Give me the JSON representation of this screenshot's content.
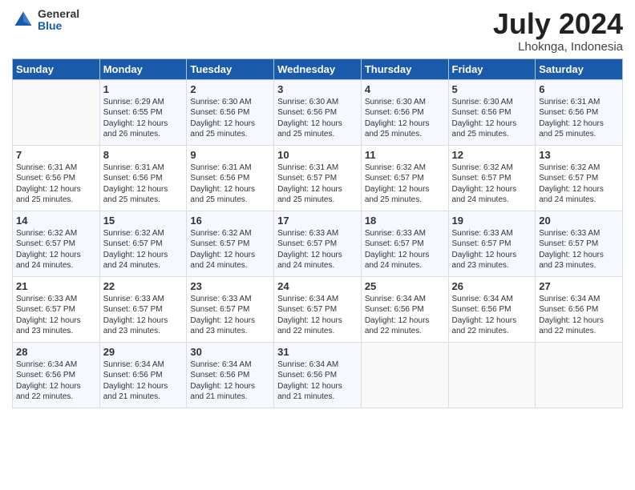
{
  "header": {
    "logo_general": "General",
    "logo_blue": "Blue",
    "month_year": "July 2024",
    "location": "Lhoknga, Indonesia"
  },
  "days_of_week": [
    "Sunday",
    "Monday",
    "Tuesday",
    "Wednesday",
    "Thursday",
    "Friday",
    "Saturday"
  ],
  "weeks": [
    [
      {
        "day": "",
        "sunrise": "",
        "sunset": "",
        "daylight": ""
      },
      {
        "day": "1",
        "sunrise": "6:29 AM",
        "sunset": "6:55 PM",
        "daylight": "12 hours and 26 minutes."
      },
      {
        "day": "2",
        "sunrise": "6:30 AM",
        "sunset": "6:56 PM",
        "daylight": "12 hours and 25 minutes."
      },
      {
        "day": "3",
        "sunrise": "6:30 AM",
        "sunset": "6:56 PM",
        "daylight": "12 hours and 25 minutes."
      },
      {
        "day": "4",
        "sunrise": "6:30 AM",
        "sunset": "6:56 PM",
        "daylight": "12 hours and 25 minutes."
      },
      {
        "day": "5",
        "sunrise": "6:30 AM",
        "sunset": "6:56 PM",
        "daylight": "12 hours and 25 minutes."
      },
      {
        "day": "6",
        "sunrise": "6:31 AM",
        "sunset": "6:56 PM",
        "daylight": "12 hours and 25 minutes."
      }
    ],
    [
      {
        "day": "7",
        "sunrise": "6:31 AM",
        "sunset": "6:56 PM",
        "daylight": "12 hours and 25 minutes."
      },
      {
        "day": "8",
        "sunrise": "6:31 AM",
        "sunset": "6:56 PM",
        "daylight": "12 hours and 25 minutes."
      },
      {
        "day": "9",
        "sunrise": "6:31 AM",
        "sunset": "6:56 PM",
        "daylight": "12 hours and 25 minutes."
      },
      {
        "day": "10",
        "sunrise": "6:31 AM",
        "sunset": "6:57 PM",
        "daylight": "12 hours and 25 minutes."
      },
      {
        "day": "11",
        "sunrise": "6:32 AM",
        "sunset": "6:57 PM",
        "daylight": "12 hours and 25 minutes."
      },
      {
        "day": "12",
        "sunrise": "6:32 AM",
        "sunset": "6:57 PM",
        "daylight": "12 hours and 24 minutes."
      },
      {
        "day": "13",
        "sunrise": "6:32 AM",
        "sunset": "6:57 PM",
        "daylight": "12 hours and 24 minutes."
      }
    ],
    [
      {
        "day": "14",
        "sunrise": "6:32 AM",
        "sunset": "6:57 PM",
        "daylight": "12 hours and 24 minutes."
      },
      {
        "day": "15",
        "sunrise": "6:32 AM",
        "sunset": "6:57 PM",
        "daylight": "12 hours and 24 minutes."
      },
      {
        "day": "16",
        "sunrise": "6:32 AM",
        "sunset": "6:57 PM",
        "daylight": "12 hours and 24 minutes."
      },
      {
        "day": "17",
        "sunrise": "6:33 AM",
        "sunset": "6:57 PM",
        "daylight": "12 hours and 24 minutes."
      },
      {
        "day": "18",
        "sunrise": "6:33 AM",
        "sunset": "6:57 PM",
        "daylight": "12 hours and 24 minutes."
      },
      {
        "day": "19",
        "sunrise": "6:33 AM",
        "sunset": "6:57 PM",
        "daylight": "12 hours and 23 minutes."
      },
      {
        "day": "20",
        "sunrise": "6:33 AM",
        "sunset": "6:57 PM",
        "daylight": "12 hours and 23 minutes."
      }
    ],
    [
      {
        "day": "21",
        "sunrise": "6:33 AM",
        "sunset": "6:57 PM",
        "daylight": "12 hours and 23 minutes."
      },
      {
        "day": "22",
        "sunrise": "6:33 AM",
        "sunset": "6:57 PM",
        "daylight": "12 hours and 23 minutes."
      },
      {
        "day": "23",
        "sunrise": "6:33 AM",
        "sunset": "6:57 PM",
        "daylight": "12 hours and 23 minutes."
      },
      {
        "day": "24",
        "sunrise": "6:34 AM",
        "sunset": "6:57 PM",
        "daylight": "12 hours and 22 minutes."
      },
      {
        "day": "25",
        "sunrise": "6:34 AM",
        "sunset": "6:56 PM",
        "daylight": "12 hours and 22 minutes."
      },
      {
        "day": "26",
        "sunrise": "6:34 AM",
        "sunset": "6:56 PM",
        "daylight": "12 hours and 22 minutes."
      },
      {
        "day": "27",
        "sunrise": "6:34 AM",
        "sunset": "6:56 PM",
        "daylight": "12 hours and 22 minutes."
      }
    ],
    [
      {
        "day": "28",
        "sunrise": "6:34 AM",
        "sunset": "6:56 PM",
        "daylight": "12 hours and 22 minutes."
      },
      {
        "day": "29",
        "sunrise": "6:34 AM",
        "sunset": "6:56 PM",
        "daylight": "12 hours and 21 minutes."
      },
      {
        "day": "30",
        "sunrise": "6:34 AM",
        "sunset": "6:56 PM",
        "daylight": "12 hours and 21 minutes."
      },
      {
        "day": "31",
        "sunrise": "6:34 AM",
        "sunset": "6:56 PM",
        "daylight": "12 hours and 21 minutes."
      },
      {
        "day": "",
        "sunrise": "",
        "sunset": "",
        "daylight": ""
      },
      {
        "day": "",
        "sunrise": "",
        "sunset": "",
        "daylight": ""
      },
      {
        "day": "",
        "sunrise": "",
        "sunset": "",
        "daylight": ""
      }
    ]
  ]
}
